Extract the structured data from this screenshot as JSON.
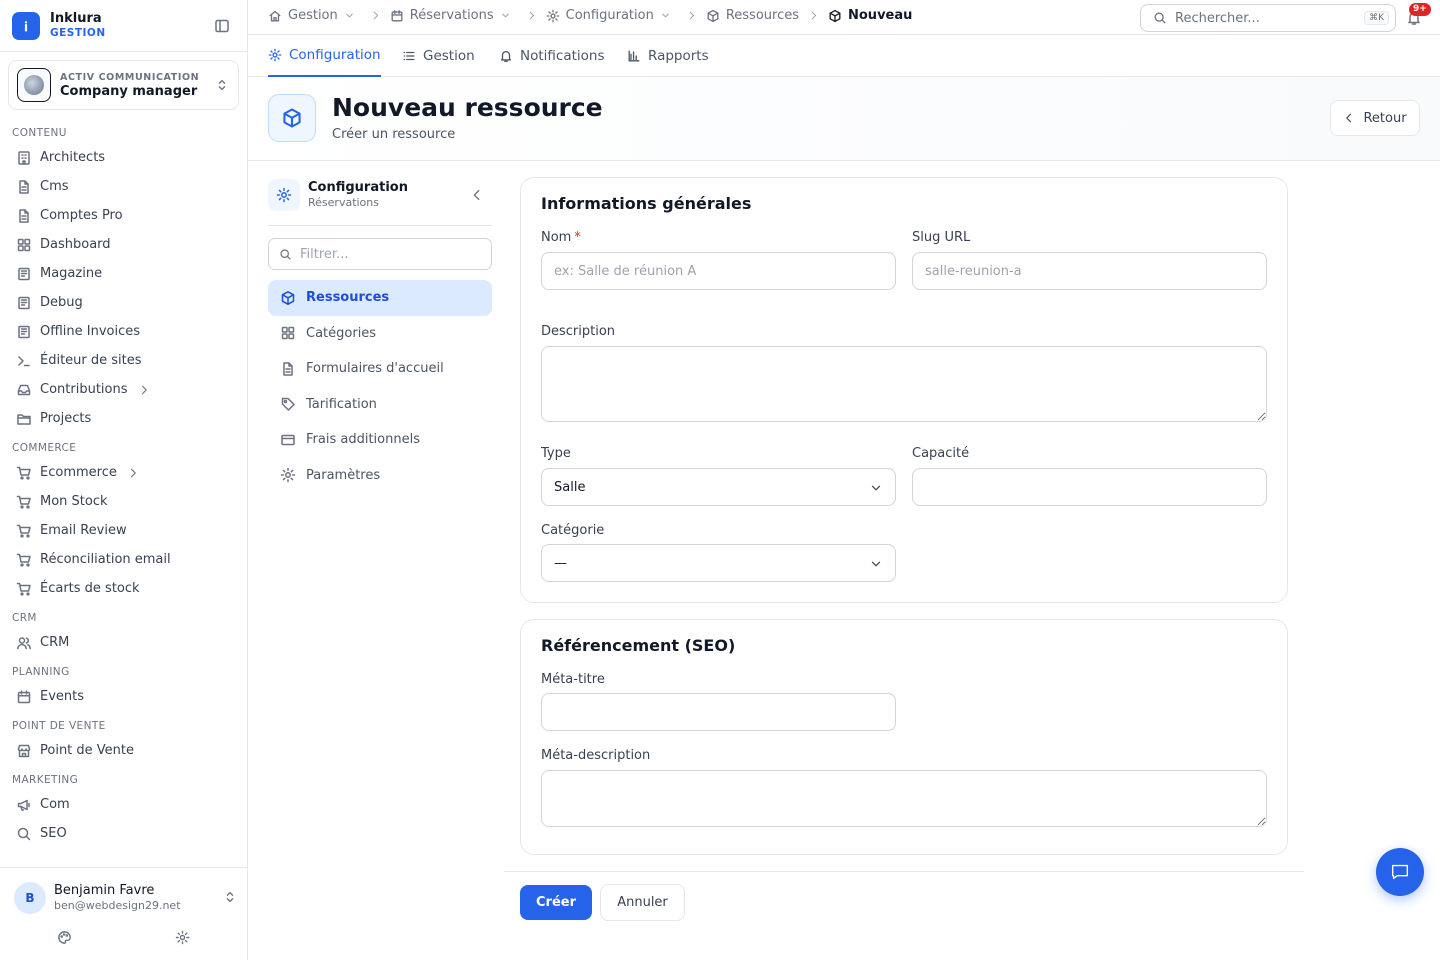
{
  "brand": {
    "name": "Inklura",
    "subtitle": "GESTION"
  },
  "org": {
    "subtitle": "ACTIV COMMUNICATION",
    "name": "Company manager"
  },
  "sidebar": {
    "sections": [
      {
        "title": "CONTENU",
        "items": [
          {
            "label": "Architects",
            "icon": "building-icon"
          },
          {
            "label": "Cms",
            "icon": "file-icon"
          },
          {
            "label": "Comptes Pro",
            "icon": "file-icon"
          },
          {
            "label": "Dashboard",
            "icon": "grid-icon"
          },
          {
            "label": "Magazine",
            "icon": "newspaper-icon"
          },
          {
            "label": "Debug",
            "icon": "newspaper-icon"
          },
          {
            "label": "Offline Invoices",
            "icon": "newspaper-icon"
          },
          {
            "label": "Éditeur de sites",
            "icon": "terminal-icon"
          },
          {
            "label": "Contributions",
            "icon": "inbox-icon",
            "chevron": true
          },
          {
            "label": "Projects",
            "icon": "folder-icon"
          }
        ]
      },
      {
        "title": "COMMERCE",
        "items": [
          {
            "label": "Ecommerce",
            "icon": "cart-icon",
            "chevron": true
          },
          {
            "label": "Mon Stock",
            "icon": "cart-icon"
          },
          {
            "label": "Email Review",
            "icon": "cart-icon"
          },
          {
            "label": "Réconciliation email",
            "icon": "cart-icon"
          },
          {
            "label": "Écarts de stock",
            "icon": "cart-icon"
          }
        ]
      },
      {
        "title": "CRM",
        "items": [
          {
            "label": "CRM",
            "icon": "users-icon"
          }
        ]
      },
      {
        "title": "PLANNING",
        "items": [
          {
            "label": "Events",
            "icon": "calendar-icon"
          }
        ]
      },
      {
        "title": "POINT DE VENTE",
        "items": [
          {
            "label": "Point de Vente",
            "icon": "store-icon"
          }
        ]
      },
      {
        "title": "MARKETING",
        "items": [
          {
            "label": "Com",
            "icon": "megaphone-icon"
          },
          {
            "label": "SEO",
            "icon": "search-icon"
          }
        ]
      }
    ]
  },
  "user": {
    "initial": "B",
    "name": "Benjamin Favre",
    "email": "ben@webdesign29.net"
  },
  "breadcrumb": [
    {
      "label": "Gestion",
      "icon": "home-icon",
      "dropdown": true
    },
    {
      "label": "Réservations",
      "icon": "calendar-icon",
      "dropdown": true
    },
    {
      "label": "Configuration",
      "icon": "gear-icon",
      "dropdown": true
    },
    {
      "label": "Ressources",
      "icon": "box-icon",
      "dropdown": false
    },
    {
      "label": "Nouveau",
      "icon": "box-icon",
      "dropdown": false,
      "active": true
    }
  ],
  "search": {
    "placeholder": "Rechercher...",
    "shortcut": "⌘K"
  },
  "notifications": {
    "badge": "9+"
  },
  "tabs": [
    {
      "label": "Configuration",
      "icon": "gear-icon",
      "active": true
    },
    {
      "label": "Gestion",
      "icon": "list-icon"
    },
    {
      "label": "Notifications",
      "icon": "bell-icon"
    },
    {
      "label": "Rapports",
      "icon": "bar-chart-icon"
    }
  ],
  "header": {
    "title": "Nouveau ressource",
    "subtitle": "Créer un ressource",
    "back_label": "Retour"
  },
  "subnav": {
    "title": "Configuration",
    "subtitle": "Réservations",
    "filter_placeholder": "Filtrer...",
    "items": [
      {
        "label": "Ressources",
        "icon": "box-icon",
        "active": true
      },
      {
        "label": "Catégories",
        "icon": "grid-icon"
      },
      {
        "label": "Formulaires d'accueil",
        "icon": "file-icon"
      },
      {
        "label": "Tarification",
        "icon": "tag-icon"
      },
      {
        "label": "Frais additionnels",
        "icon": "credit-card-icon"
      },
      {
        "label": "Paramètres",
        "icon": "gear-icon"
      }
    ]
  },
  "form": {
    "general": {
      "title": "Informations générales",
      "name_label": "Nom",
      "name_required": "*",
      "name_placeholder": "ex: Salle de réunion A",
      "slug_label": "Slug URL",
      "slug_placeholder": "salle-reunion-a",
      "description_label": "Description",
      "type_label": "Type",
      "type_value": "Salle",
      "capacity_label": "Capacité",
      "category_label": "Catégorie",
      "category_value": "—"
    },
    "seo": {
      "title": "Référencement (SEO)",
      "meta_title_label": "Méta-titre",
      "meta_description_label": "Méta-description"
    }
  },
  "actions": {
    "create_label": "Créer",
    "cancel_label": "Annuler"
  }
}
